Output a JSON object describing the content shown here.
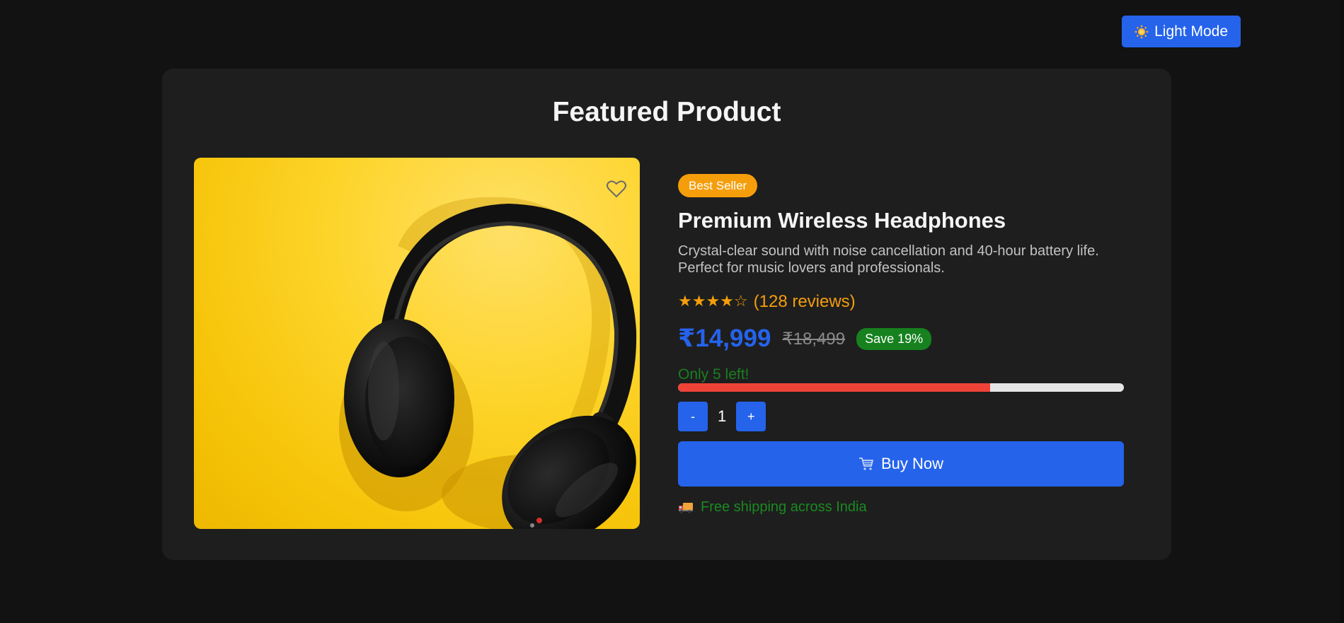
{
  "theme_toggle": {
    "label": "Light Mode",
    "icon": "sun-icon"
  },
  "card": {
    "title": "Featured Product"
  },
  "product": {
    "image_alt": "headphones",
    "badge": "Best Seller",
    "name": "Premium Wireless Headphones",
    "description_line1": "Crystal-clear sound with noise cancellation and 40-hour battery life.",
    "description_line2": "Perfect for music lovers and professionals.",
    "stars": "★★★★☆",
    "reviews": "(128 reviews)",
    "rating_value": 4,
    "price": "₹14,999",
    "old_price": "₹18,499",
    "save": "Save 19%",
    "stock_text": "Only 5 left!",
    "stock_fraction": 0.7,
    "quantity": "1",
    "qty_decrement": "-",
    "qty_increment": "+",
    "buy_label": "Buy Now",
    "shipping": "Free shipping across India"
  },
  "colors": {
    "accent": "#2563eb",
    "badge": "#f59e0b",
    "save": "#16811e",
    "stock_fill": "#ef4338",
    "stock_text": "#1a7f20",
    "background": "#121212",
    "card": "#1e1e1e"
  }
}
